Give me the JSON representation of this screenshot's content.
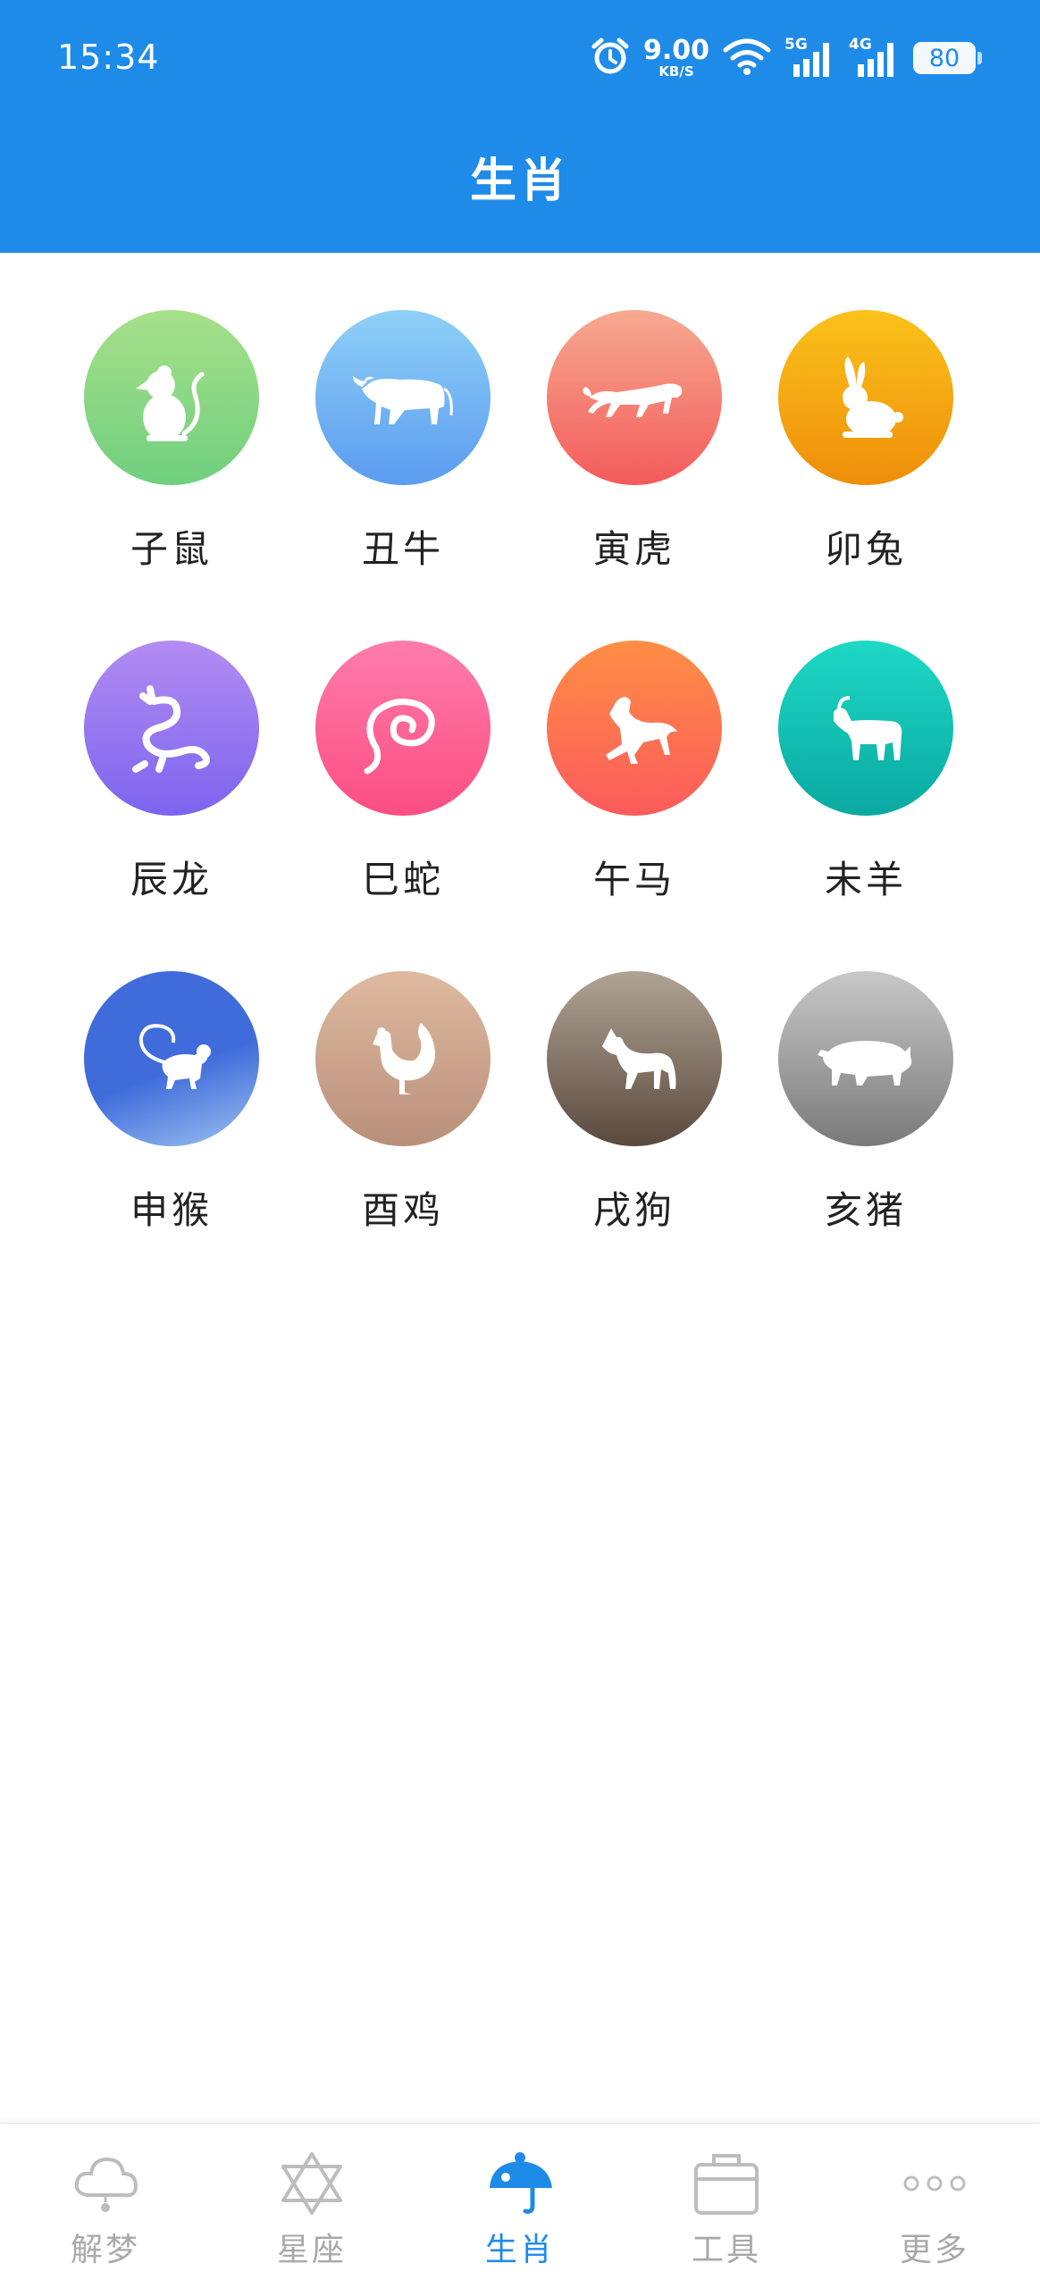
{
  "status_bar": {
    "time": "15:34",
    "speed_value": "9.00",
    "speed_unit": "KB/S",
    "network_5g": "5G",
    "network_4g": "4G",
    "battery": "80"
  },
  "header": {
    "title": "生肖"
  },
  "zodiac": [
    {
      "label": "子鼠",
      "icon": "rat-icon",
      "colors": [
        "#a7e08a",
        "#6fcf7e"
      ]
    },
    {
      "label": "丑牛",
      "icon": "ox-icon",
      "colors": [
        "#8ed0f7",
        "#5b9cf0"
      ]
    },
    {
      "label": "寅虎",
      "icon": "tiger-icon",
      "colors": [
        "#f7a990",
        "#f45b5b"
      ]
    },
    {
      "label": "卯兔",
      "icon": "rabbit-icon",
      "colors": [
        "#fbc21a",
        "#ee8e0b"
      ]
    },
    {
      "label": "辰龙",
      "icon": "dragon-icon",
      "colors": [
        "#b38cf2",
        "#7b64ee"
      ]
    },
    {
      "label": "巳蛇",
      "icon": "snake-icon",
      "colors": [
        "#ff7cab",
        "#fb4e83"
      ]
    },
    {
      "label": "午马",
      "icon": "horse-icon",
      "colors": [
        "#ff8e45",
        "#fb5b5c"
      ]
    },
    {
      "label": "未羊",
      "icon": "goat-icon",
      "colors": [
        "#1ed8c5",
        "#0aa9a1"
      ]
    },
    {
      "label": "申猴",
      "icon": "monkey-icon",
      "colors": [
        "#3f6cda",
        "#9cc1f0"
      ]
    },
    {
      "label": "酉鸡",
      "icon": "rooster-icon",
      "colors": [
        "#dfb9a0",
        "#b9907a"
      ]
    },
    {
      "label": "戌狗",
      "icon": "dog-icon",
      "colors": [
        "#b0a394",
        "#5a4a3e"
      ]
    },
    {
      "label": "亥猪",
      "icon": "pig-icon",
      "colors": [
        "#c8c8c8",
        "#7a7a7a"
      ]
    }
  ],
  "bottom_nav": [
    {
      "label": "解梦",
      "icon": "cloud-icon",
      "active": false
    },
    {
      "label": "星座",
      "icon": "star-of-david-icon",
      "active": false
    },
    {
      "label": "生肖",
      "icon": "bird-icon",
      "active": true
    },
    {
      "label": "工具",
      "icon": "toolbox-icon",
      "active": false
    },
    {
      "label": "更多",
      "icon": "more-dots-icon",
      "active": false
    }
  ],
  "colors": {
    "primary": "#1f8be8",
    "nav_inactive": "#a9a9a9",
    "label_text": "#222222"
  }
}
